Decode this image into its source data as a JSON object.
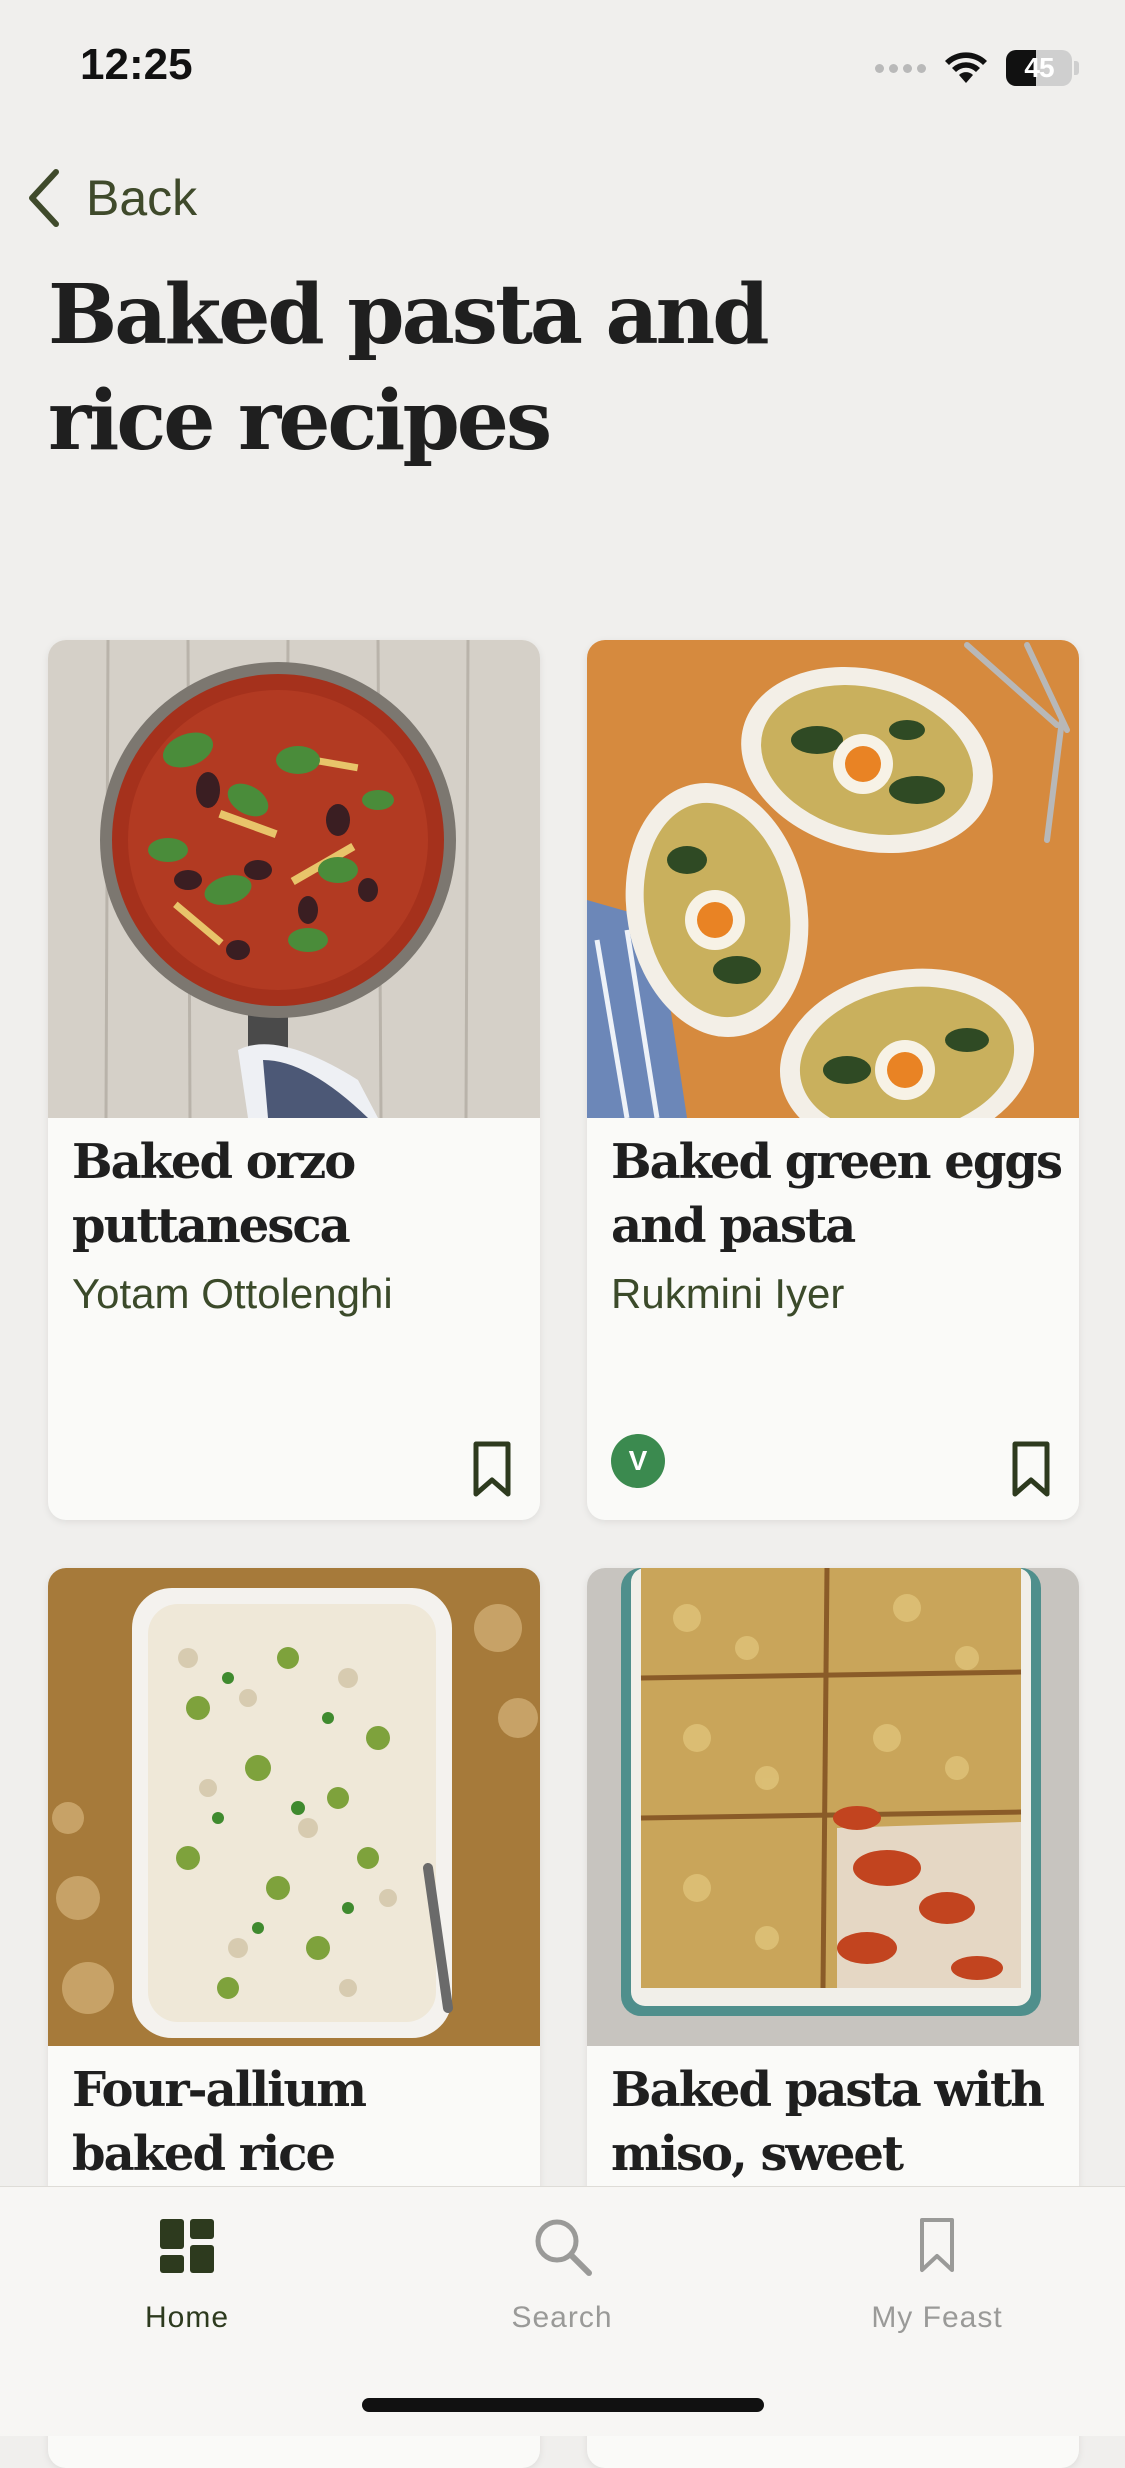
{
  "status_bar": {
    "time": "12:25",
    "battery": "45",
    "battery_level": 0.45
  },
  "nav": {
    "back_label": "Back"
  },
  "page": {
    "title_line1": "Baked pasta and",
    "title_line2": "rice recipes"
  },
  "recipes": [
    {
      "title_line1": "Baked orzo",
      "title_line2": "puttanesca",
      "author": "Yotam Ottolenghi",
      "vegetarian": false
    },
    {
      "title_line1": "Baked green eggs",
      "title_line2": "and pasta",
      "author": "Rukmini Iyer",
      "vegetarian": true,
      "badge": "V"
    },
    {
      "title_line1": "Four-allium",
      "title_line2": "baked rice"
    },
    {
      "title_line1": "Baked pasta with",
      "title_line2": "miso, sweet"
    }
  ],
  "tab_bar": {
    "tabs": [
      {
        "label": "Home",
        "icon": "home-grid-icon",
        "active": true
      },
      {
        "label": "Search",
        "icon": "search-icon",
        "active": false
      },
      {
        "label": "My Feast",
        "icon": "bookmark-icon",
        "active": false
      }
    ]
  },
  "colors": {
    "background": "#f0efed",
    "accent_green": "#3f4a2b",
    "veg_badge": "#3b8a4f",
    "card": "#fafaf8"
  }
}
